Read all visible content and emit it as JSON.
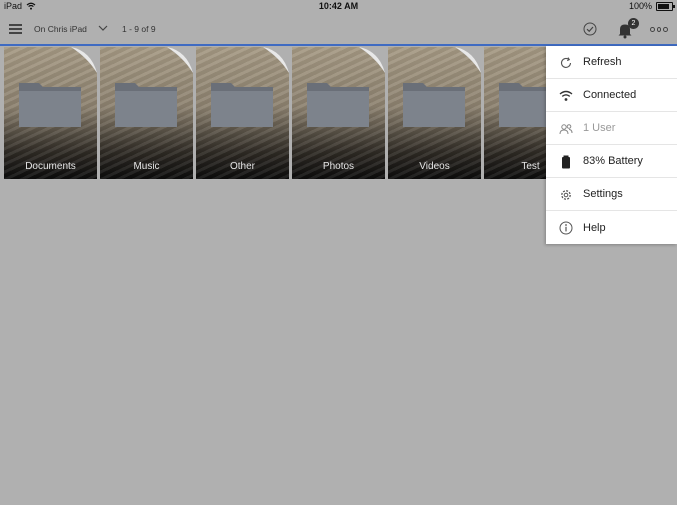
{
  "status_bar": {
    "device": "iPad",
    "time": "10:42 AM",
    "battery_percent": "100%"
  },
  "toolbar": {
    "location": "On Chris iPad",
    "count": "1 - 9 of 9",
    "notification_count": "2",
    "accent_color": "#3f6bc2"
  },
  "folders": [
    {
      "label": "Documents"
    },
    {
      "label": "Music"
    },
    {
      "label": "Other"
    },
    {
      "label": "Photos"
    },
    {
      "label": "Videos"
    },
    {
      "label": "Test"
    }
  ],
  "menu": {
    "items": [
      {
        "label": "Refresh",
        "icon": "refresh-icon",
        "enabled": true
      },
      {
        "label": "Connected",
        "icon": "wifi-icon",
        "enabled": true
      },
      {
        "label": "1 User",
        "icon": "users-icon",
        "enabled": false
      },
      {
        "label": "83% Battery",
        "icon": "battery-icon",
        "enabled": true
      },
      {
        "label": "Settings",
        "icon": "gear-icon",
        "enabled": true
      },
      {
        "label": "Help",
        "icon": "info-icon",
        "enabled": true
      }
    ]
  }
}
